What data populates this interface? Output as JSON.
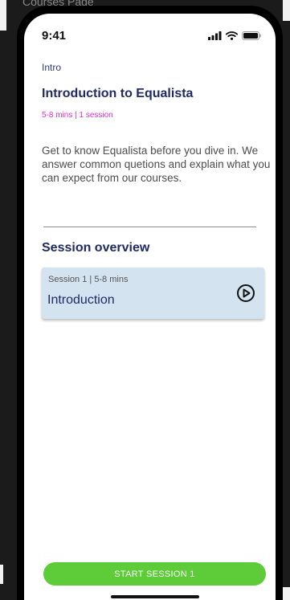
{
  "frame": {
    "label": "Courses Page"
  },
  "status_bar": {
    "time": "9:41",
    "icons": [
      "signal-icon",
      "wifi-icon",
      "battery-icon"
    ]
  },
  "breadcrumb": "Intro",
  "course": {
    "title": "Introduction to Equalista",
    "meta": "5-8 mins | 1 session",
    "description": "Get to know Equalista before you dive in. We answer common quetions and explain what you can expect from our courses."
  },
  "sessions_section": {
    "title": "Session overview",
    "sessions": [
      {
        "meta": "Session 1 | 5-8 mins",
        "title": "Introduction",
        "icon": "play-icon"
      }
    ]
  },
  "start_button": {
    "label": "START SESSION 1"
  },
  "colors": {
    "heading": "#1f2a66",
    "meta_accent": "#e02fd8",
    "card_background": "#d3e3ef",
    "primary_button": "#5ecb38"
  }
}
